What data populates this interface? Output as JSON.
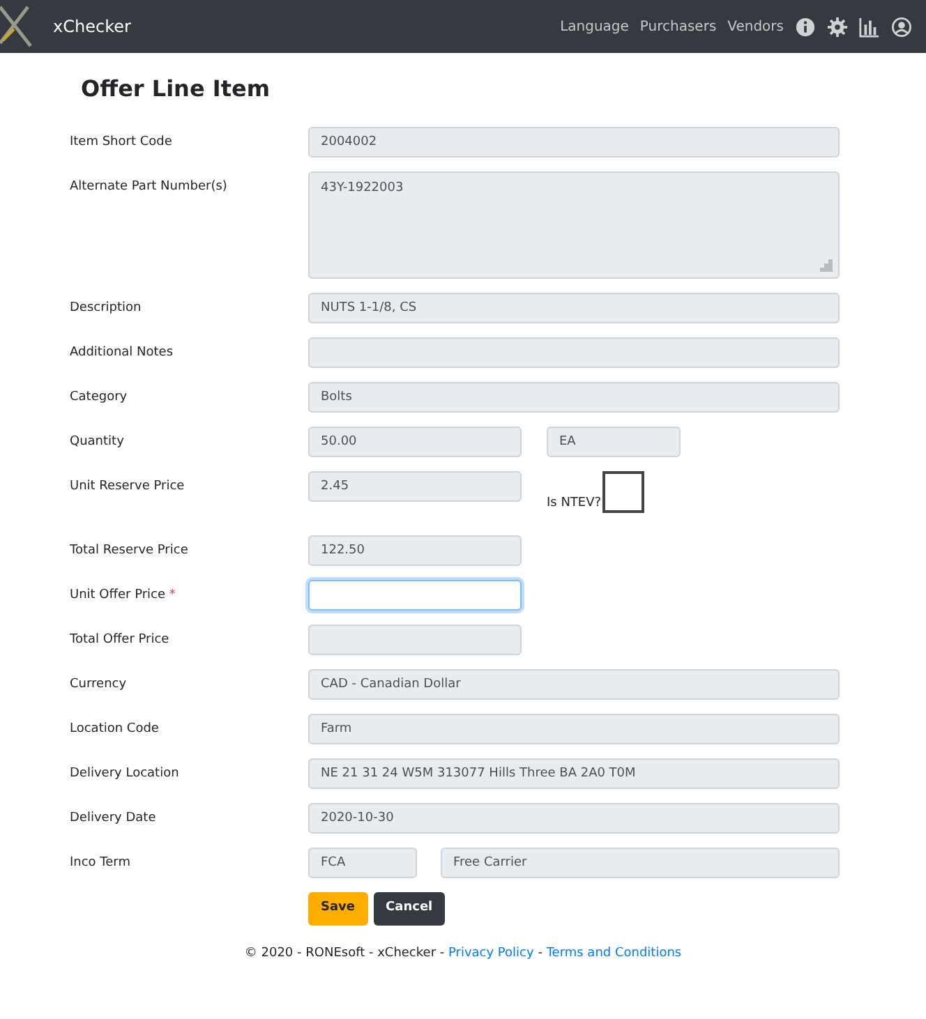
{
  "navbar": {
    "brand": "xChecker",
    "links": [
      "Language",
      "Purchasers",
      "Vendors"
    ]
  },
  "title": "Offer Line Item",
  "rows": [
    {
      "label": "Item Short Code",
      "fields": [
        {
          "kind": "input",
          "value": "2004002",
          "disabled": true,
          "focused": false
        }
      ]
    },
    {
      "label": "Alternate Part Number(s)",
      "fields": [
        {
          "kind": "textarea",
          "value": "43Y-1922003",
          "disabled": true,
          "focused": false
        }
      ]
    },
    {
      "label": "Description",
      "fields": [
        {
          "kind": "input",
          "value": "NUTS 1-1/8, CS",
          "disabled": true,
          "focused": false
        }
      ]
    },
    {
      "label": "Additional Notes",
      "fields": [
        {
          "kind": "input",
          "disabled": true,
          "focused": false
        }
      ]
    },
    {
      "label": "Category",
      "fields": [
        {
          "kind": "input",
          "value": "Bolts",
          "disabled": true,
          "focused": false
        }
      ]
    },
    {
      "label": "Quantity",
      "fields": [
        {
          "kind": "short-input",
          "value": "50.00",
          "disabled": true,
          "focused": false
        },
        {
          "kind": "unit-input",
          "value": "EA",
          "disabled": true,
          "focused": false
        }
      ]
    },
    {
      "label": "Unit Reserve Price",
      "fields": [
        {
          "kind": "short-input",
          "value": "2.45",
          "disabled": true,
          "focused": false
        },
        {
          "kind": "checkbox",
          "label": "Is NTEV?",
          "checked": false
        }
      ]
    },
    {
      "label": "Total Reserve Price",
      "fields": [
        {
          "kind": "short-input",
          "value": "122.50",
          "disabled": true,
          "focused": false
        }
      ]
    },
    {
      "label": "Unit Offer Price",
      "marker": "*",
      "fields": [
        {
          "kind": "short-input",
          "disabled": false,
          "focused": true
        }
      ]
    },
    {
      "label": "Total Offer Price",
      "fields": [
        {
          "kind": "short-input",
          "disabled": true,
          "focused": false
        }
      ]
    },
    {
      "label": "Currency",
      "fields": [
        {
          "kind": "input",
          "value": "CAD - Canadian Dollar",
          "disabled": true,
          "focused": false
        }
      ]
    },
    {
      "label": "Location Code",
      "fields": [
        {
          "kind": "input",
          "value": "Farm",
          "disabled": true,
          "focused": false
        }
      ]
    },
    {
      "label": "Delivery Location",
      "fields": [
        {
          "kind": "input",
          "value": "NE 21 31 24 W5M 313077 Hills Three BA 2A0 T0M",
          "disabled": true,
          "focused": false
        }
      ]
    },
    {
      "label": "Delivery Date",
      "fields": [
        {
          "kind": "input",
          "value": "2020-10-30",
          "disabled": true,
          "focused": false
        }
      ]
    },
    {
      "label": "Inco Term",
      "fields": [
        {
          "kind": "code-input",
          "value": "FCA",
          "disabled": true,
          "focused": false
        },
        {
          "kind": "rest-input",
          "value": "Free Carrier",
          "disabled": true,
          "focused": false
        }
      ]
    }
  ],
  "buttons": [
    {
      "label": "Save",
      "kind": "primary"
    },
    {
      "label": "Cancel",
      "kind": "secondary"
    }
  ],
  "footer": [
    {
      "kind": "text",
      "text": "© 2020 - RONEsoft - xChecker - "
    },
    {
      "kind": "link",
      "text": "Privacy Policy"
    },
    {
      "kind": "text",
      "text": " - "
    },
    {
      "kind": "link",
      "text": "Terms and Conditions"
    }
  ]
}
